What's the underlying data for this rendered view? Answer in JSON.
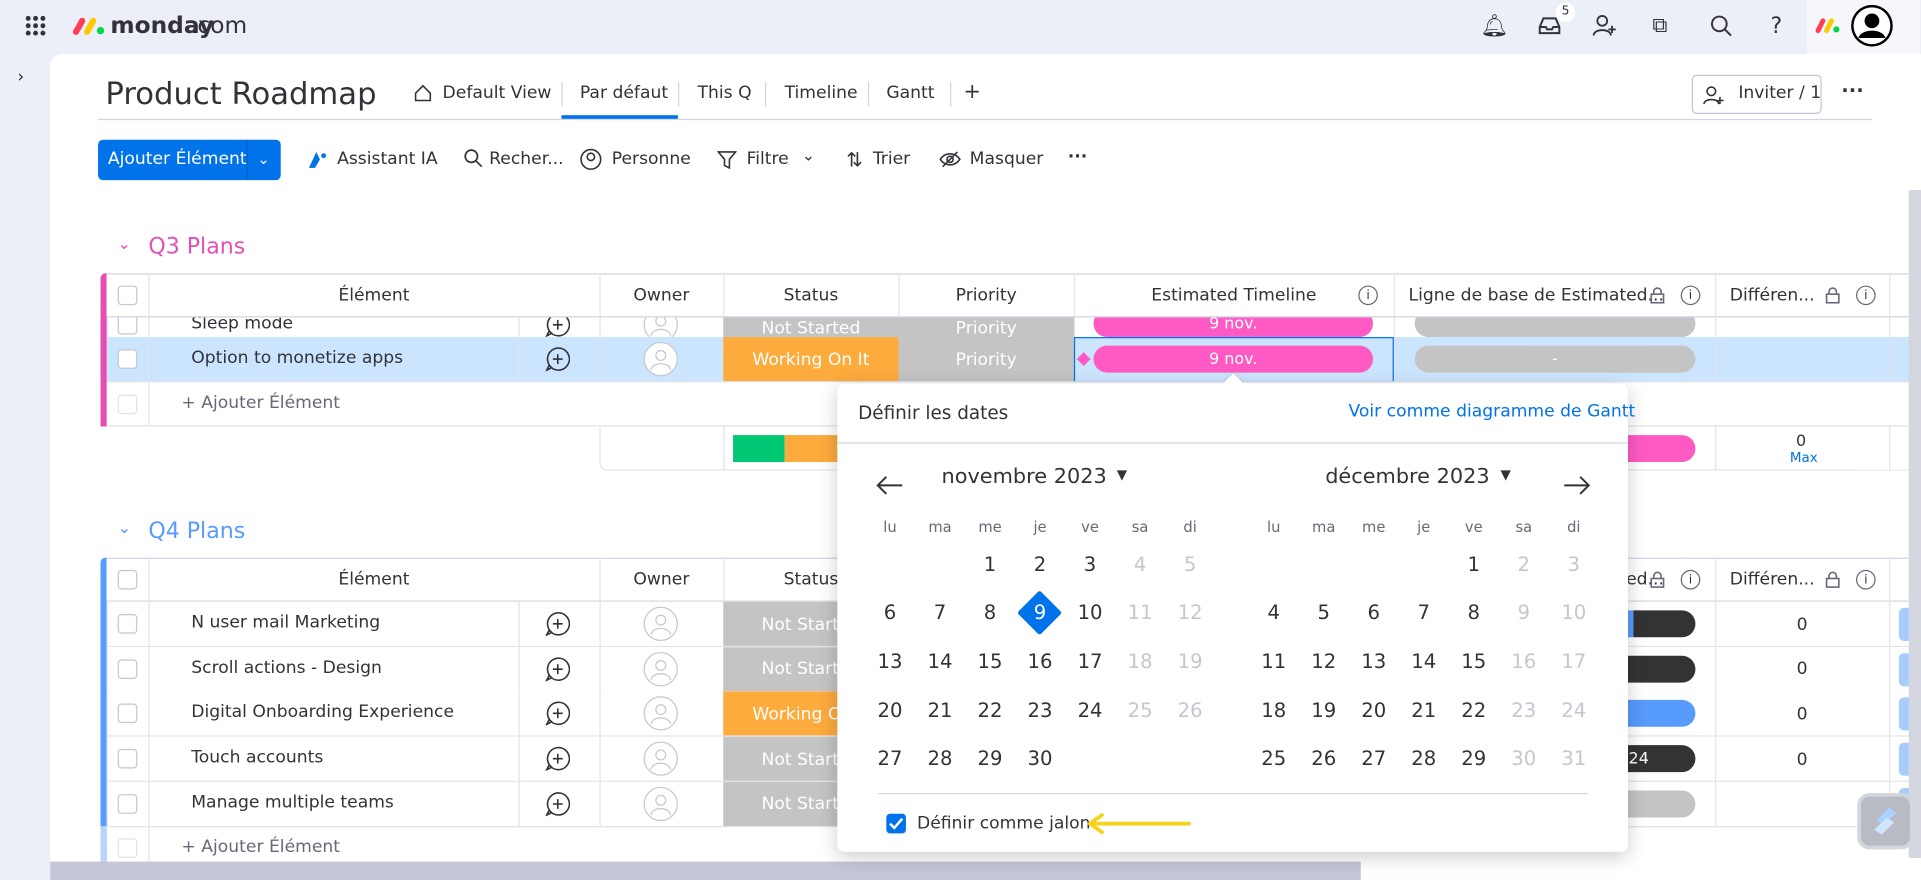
{
  "topbar": {
    "brand": "monday",
    "brand_suffix": ".com",
    "inbox_badge": "5"
  },
  "header": {
    "title": "Product Roadmap",
    "tabs": [
      {
        "label": "Default View",
        "active": false
      },
      {
        "label": "Par défaut",
        "active": true
      },
      {
        "label": "This Q",
        "active": false
      },
      {
        "label": "Timeline",
        "active": false
      },
      {
        "label": "Gantt",
        "active": false
      }
    ],
    "add_tab": "+",
    "invite_label": "Inviter / 1",
    "more": "···"
  },
  "toolbar": {
    "add_item": "Ajouter Élément",
    "assistant": "Assistant IA",
    "search": "Recher...",
    "person": "Personne",
    "filter": "Filtre",
    "sort": "Trier",
    "hide": "Masquer",
    "more": "···"
  },
  "columns": {
    "item": "Élément",
    "owner": "Owner",
    "status": "Status",
    "priority": "Priority",
    "timeline": "Estimated Timeline",
    "baseline": "Ligne de base de Estimated...",
    "diff": "Différen..."
  },
  "groups": {
    "q3": {
      "title": "Q3 Plans",
      "color": "#e44fb5",
      "partial_row": {
        "name": "Sleep mode",
        "status": "Not Started",
        "priority": "Priority",
        "timeline": "9 nov."
      },
      "selected_row": {
        "name": "Option to monetize apps",
        "status": "Working On It",
        "priority": "Priority",
        "timeline": "9 nov.",
        "baseline": "-"
      },
      "add_item": "+ Ajouter Élément",
      "summary": {
        "diff": "0",
        "diff_label": "Max"
      }
    },
    "q4": {
      "title": "Q4 Plans",
      "color": "#579bfc",
      "rows": [
        {
          "name": "N user mail Marketing",
          "status": "Not Started",
          "baseline_text": "",
          "diff": "0"
        },
        {
          "name": "Scroll actions - Design",
          "status": "Not Started",
          "baseline_text": "",
          "diff": "0"
        },
        {
          "name": "Digital Onboarding Experience",
          "status": "Working On It",
          "baseline_text": "",
          "diff": "0"
        },
        {
          "name": "Touch accounts",
          "status": "Not Started",
          "baseline_text": "24",
          "diff": "0"
        },
        {
          "name": "Manage multiple teams",
          "status": "Not Started",
          "baseline_text": "",
          "diff": ""
        }
      ],
      "add_item": "+ Ajouter Élément"
    }
  },
  "colors": {
    "accent": "#0073ea",
    "working": "#fdab3d",
    "not_started": "#c4c4c4",
    "done": "#00c875",
    "selected_row": "#cce5ff",
    "timeline_pink": "#ff5ac4",
    "milestone_arrow": "#f5d31a"
  },
  "datepicker": {
    "title": "Définir les dates",
    "gantt_link": "Voir comme diagramme de Gantt",
    "weekdays": [
      "lu",
      "ma",
      "me",
      "je",
      "ve",
      "sa",
      "di"
    ],
    "months": [
      {
        "label": "novembre 2023",
        "weeks": [
          [
            "",
            "",
            "1",
            "2",
            "3",
            "4",
            "5"
          ],
          [
            "6",
            "7",
            "8",
            "9",
            "10",
            "11",
            "12"
          ],
          [
            "13",
            "14",
            "15",
            "16",
            "17",
            "18",
            "19"
          ],
          [
            "20",
            "21",
            "22",
            "23",
            "24",
            "25",
            "26"
          ],
          [
            "27",
            "28",
            "29",
            "30",
            "",
            "",
            ""
          ]
        ]
      },
      {
        "label": "décembre 2023",
        "weeks": [
          [
            "",
            "",
            "",
            "",
            "1",
            "2",
            "3"
          ],
          [
            "4",
            "5",
            "6",
            "7",
            "8",
            "9",
            "10"
          ],
          [
            "11",
            "12",
            "13",
            "14",
            "15",
            "16",
            "17"
          ],
          [
            "18",
            "19",
            "20",
            "21",
            "22",
            "23",
            "24"
          ],
          [
            "25",
            "26",
            "27",
            "28",
            "29",
            "30",
            "31"
          ]
        ]
      }
    ],
    "selected_day": "9",
    "milestone_label": "Définir comme jalon",
    "milestone_checked": true
  }
}
